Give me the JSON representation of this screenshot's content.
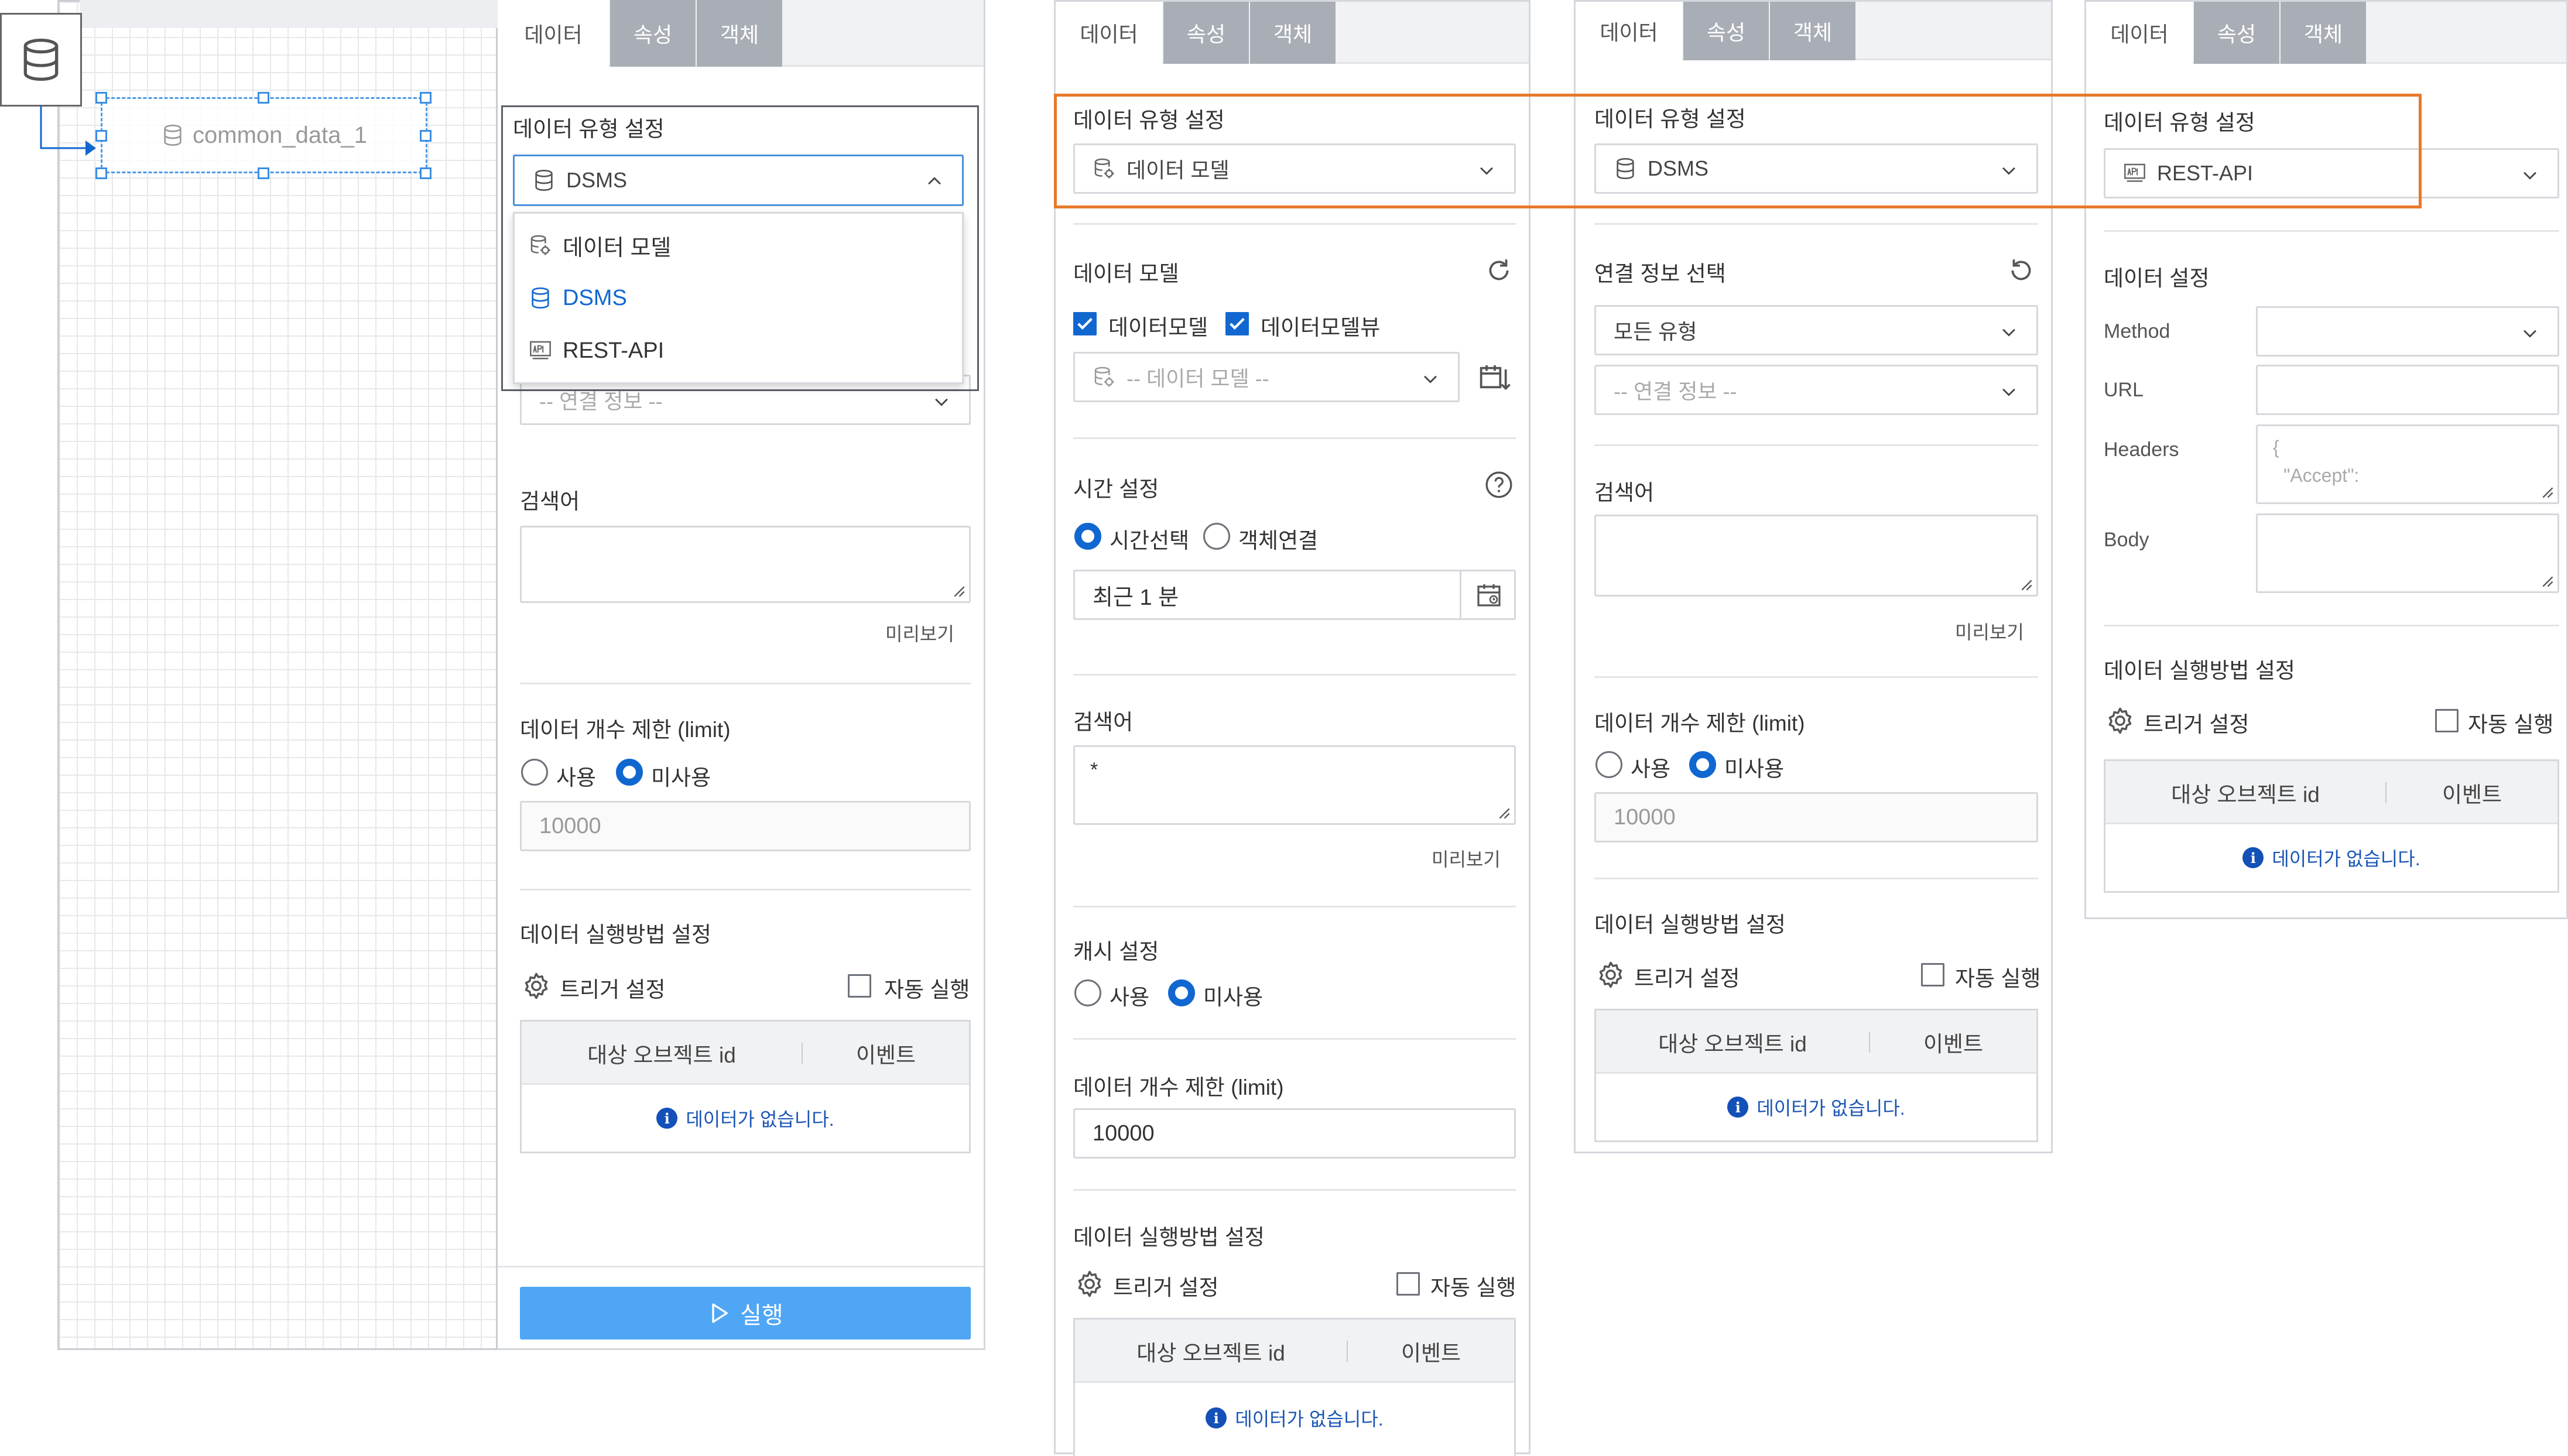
{
  "canvas": {
    "node_label": "common_data_1"
  },
  "tabs": {
    "data": "데이터",
    "props": "속성",
    "object": "객체"
  },
  "p1": {
    "type_title": "데이터 유형 설정",
    "type_value": "DSMS",
    "dropdown": [
      "데이터 모델",
      "DSMS",
      "REST-API"
    ],
    "conn_placeholder": "-- 연결 정보 --",
    "search_title": "검색어",
    "preview": "미리보기",
    "limit_title": "데이터 개수 제한 (limit)",
    "use": "사용",
    "nouse": "미사용",
    "limit_value": "10000",
    "exec_title": "데이터 실행방법 설정",
    "trigger": "트리거 설정",
    "auto": "자동 실행",
    "col_target": "대상 오브젝트 id",
    "col_event": "이벤트",
    "empty": "데이터가 없습니다.",
    "run": "실행"
  },
  "p2": {
    "type_title": "데이터 유형 설정",
    "type_value": "데이터 모델",
    "model_title": "데이터 모델",
    "chk_model": "데이터모델",
    "chk_view": "데이터모델뷰",
    "model_placeholder": "-- 데이터 모델 --",
    "time_title": "시간 설정",
    "time_select": "시간선택",
    "obj_link": "객체연결",
    "time_value": "최근 1 분",
    "search_title": "검색어",
    "search_value": "*",
    "preview": "미리보기",
    "cache_title": "캐시 설정",
    "use": "사용",
    "nouse": "미사용",
    "limit_title": "데이터 개수 제한 (limit)",
    "limit_value": "10000",
    "exec_title": "데이터 실행방법 설정",
    "trigger": "트리거 설정",
    "auto": "자동 실행",
    "col_target": "대상 오브젝트 id",
    "col_event": "이벤트",
    "empty": "데이터가 없습니다."
  },
  "p3": {
    "type_title": "데이터 유형 설정",
    "type_value": "DSMS",
    "conn_title": "연결 정보 선택",
    "all_types": "모든 유형",
    "conn_placeholder": "-- 연결 정보 --",
    "search_title": "검색어",
    "preview": "미리보기",
    "limit_title": "데이터 개수 제한 (limit)",
    "use": "사용",
    "nouse": "미사용",
    "limit_value": "10000",
    "exec_title": "데이터 실행방법 설정",
    "trigger": "트리거 설정",
    "auto": "자동 실행",
    "col_target": "대상 오브젝트 id",
    "col_event": "이벤트",
    "empty": "데이터가 없습니다."
  },
  "p4": {
    "type_title": "데이터 유형 설정",
    "type_value": "REST-API",
    "data_title": "데이터 설정",
    "method": "Method",
    "url": "URL",
    "headers": "Headers",
    "headers_value_1": "{",
    "headers_value_2": "\"Accept\":",
    "body": "Body",
    "exec_title": "데이터 실행방법 설정",
    "trigger": "트리거 설정",
    "auto": "자동 실행",
    "col_target": "대상 오브젝트 id",
    "col_event": "이벤트",
    "empty": "데이터가 없습니다."
  },
  "colors": {
    "accent": "#1167d0",
    "highlight": "#e8782a",
    "run_button": "#4fa6f5"
  }
}
